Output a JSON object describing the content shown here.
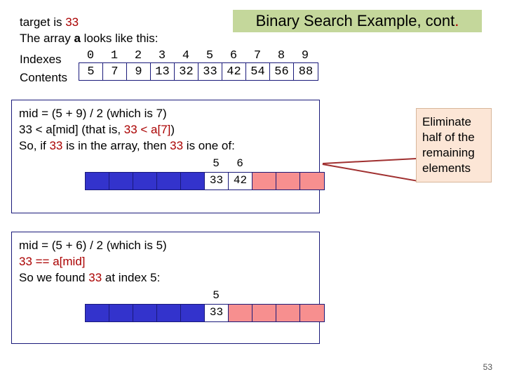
{
  "title_main": "Binary Search Example, cont",
  "title_dot": ".",
  "intro": {
    "line1a": "target is ",
    "line1b": "33",
    "line2a": "The array ",
    "line2b": "a",
    "line2c": " looks like this:",
    "label_indexes": "Indexes",
    "label_contents": "Contents"
  },
  "indexes": [
    "0",
    "1",
    "2",
    "3",
    "4",
    "5",
    "6",
    "7",
    "8",
    "9"
  ],
  "contents": [
    "5",
    "7",
    "9",
    "13",
    "32",
    "33",
    "42",
    "54",
    "56",
    "88"
  ],
  "panel1": {
    "l1": "mid = (5 + 9) / 2 (which is 7)",
    "l2a": "33 < a[mid] (that is, ",
    "l2b": "33 < a[7]",
    "l2c": ")",
    "l3a": "So, if ",
    "l3b": "33",
    "l3c": " is in the array, then ",
    "l3d": "33",
    "l3e": " is one of:",
    "idx": [
      "5",
      "6"
    ],
    "vals": [
      "33",
      "42"
    ]
  },
  "panel2": {
    "l1": "mid = (5 + 6) / 2 (which is 5)",
    "l2": "33 == a[mid]",
    "l3a": "So we found ",
    "l3b": "33",
    "l3c": " at index 5:",
    "idx": [
      "5"
    ],
    "vals": [
      "33"
    ]
  },
  "callout": "Eliminate half of the remaining elements",
  "pagenum": "53"
}
